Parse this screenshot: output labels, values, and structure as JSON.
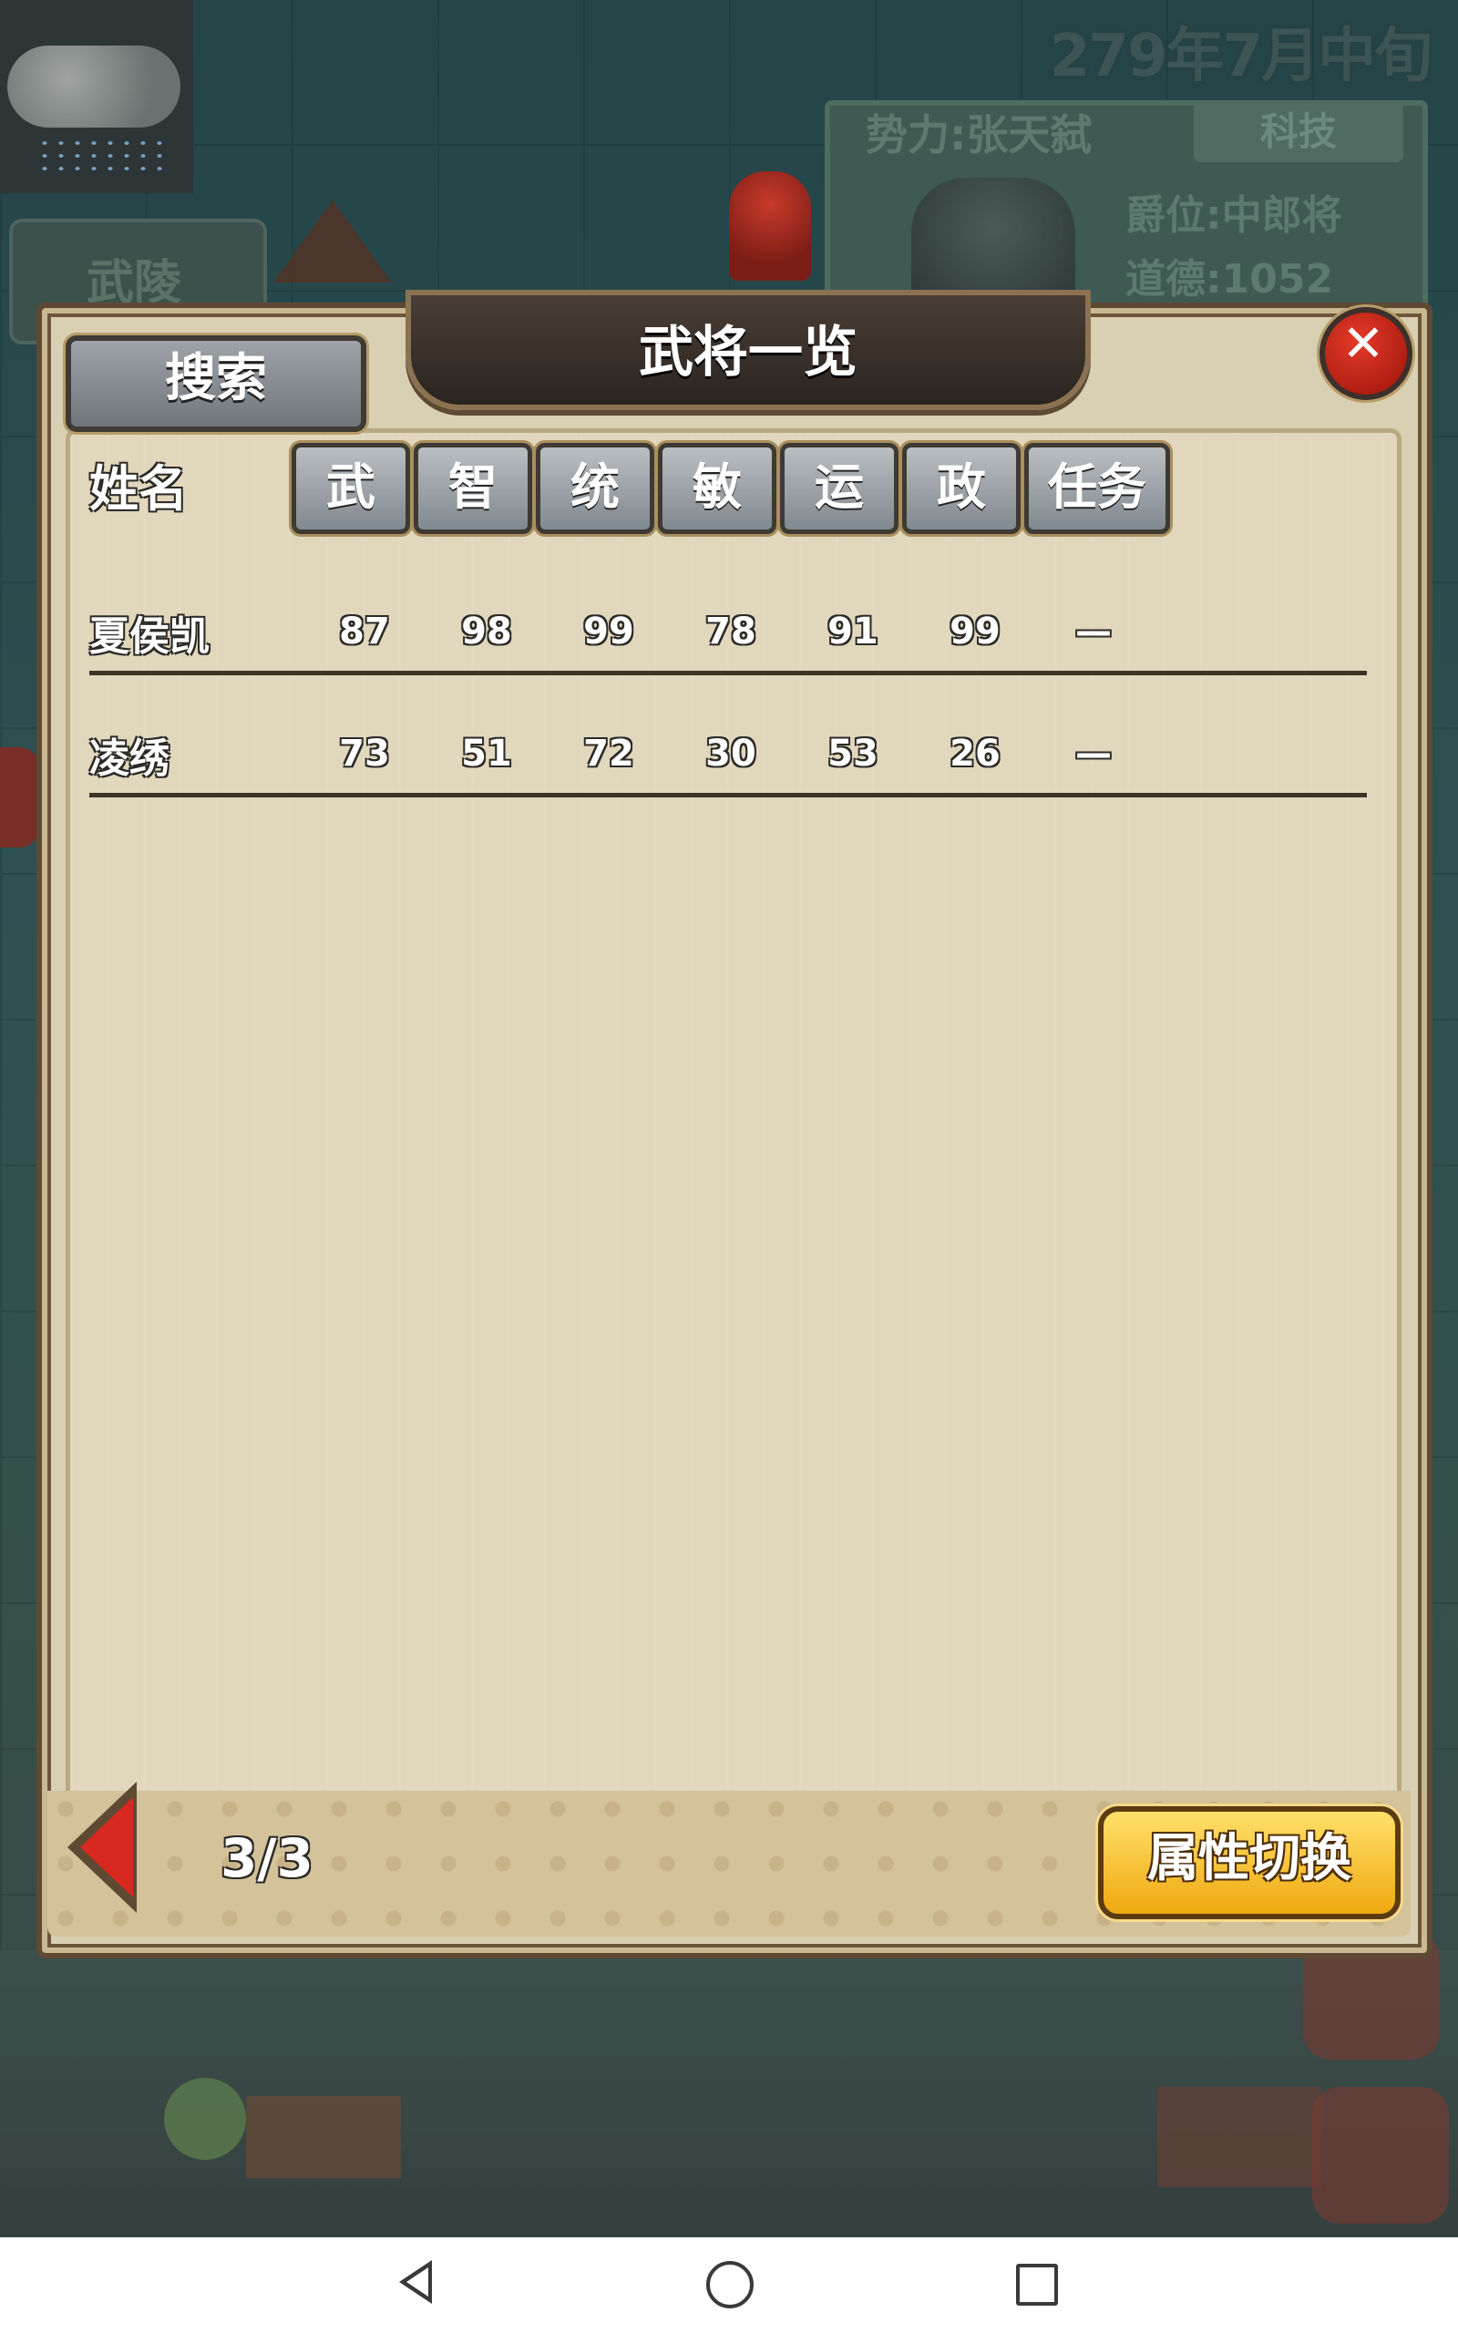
{
  "background": {
    "date": "279年7月中旬",
    "faction": "势力:张天弑",
    "tech_button": "科技",
    "rank": "爵位:中郎将",
    "morality": "道德:1052",
    "city": "武陵"
  },
  "dialog": {
    "title": "武将一览",
    "search_label": "搜索",
    "close_icon": "✕",
    "name_header": "姓名",
    "columns": [
      "武",
      "智",
      "统",
      "敏",
      "运",
      "政",
      "任务"
    ],
    "rows": [
      {
        "name": "夏侯凯",
        "values": [
          "87",
          "98",
          "99",
          "78",
          "91",
          "99",
          "—"
        ]
      },
      {
        "name": "凌绣",
        "values": [
          "73",
          "51",
          "72",
          "30",
          "53",
          "26",
          "—"
        ]
      }
    ],
    "page": "3/3",
    "switch_label": "属性切换"
  },
  "colors": {
    "accent_red": "#d7291f",
    "switch_yellow": "#f0a910",
    "panel_bg": "#d9cfb3"
  }
}
